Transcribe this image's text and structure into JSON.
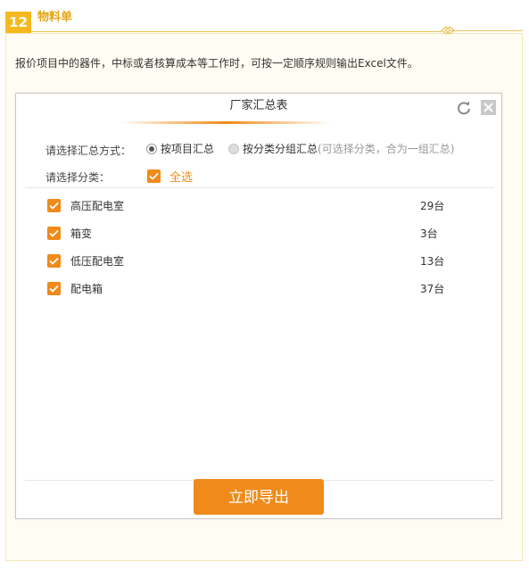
{
  "section": {
    "number": "12",
    "title": "物料单"
  },
  "description": "报价项目中的器件，中标或者核算成本等工作时，可按一定顺序规则输出Excel文件。",
  "dialog": {
    "title": "厂家汇总表",
    "summary_label": "请选择汇总方式：",
    "option_by_project": "按项目汇总",
    "option_by_category": "按分类分组汇总",
    "option_hint": "(可选择分类，合为一组汇总)",
    "category_label": "请选择分类：",
    "select_all": "全选",
    "items": [
      {
        "name": "高压配电室",
        "count": "29台"
      },
      {
        "name": "箱变",
        "count": "3台"
      },
      {
        "name": "低压配电室",
        "count": "13台"
      },
      {
        "name": "配电箱",
        "count": "37台"
      }
    ],
    "export_label": "立即导出"
  },
  "colors": {
    "accent": "#f08a1a",
    "section": "#f5b91e"
  }
}
